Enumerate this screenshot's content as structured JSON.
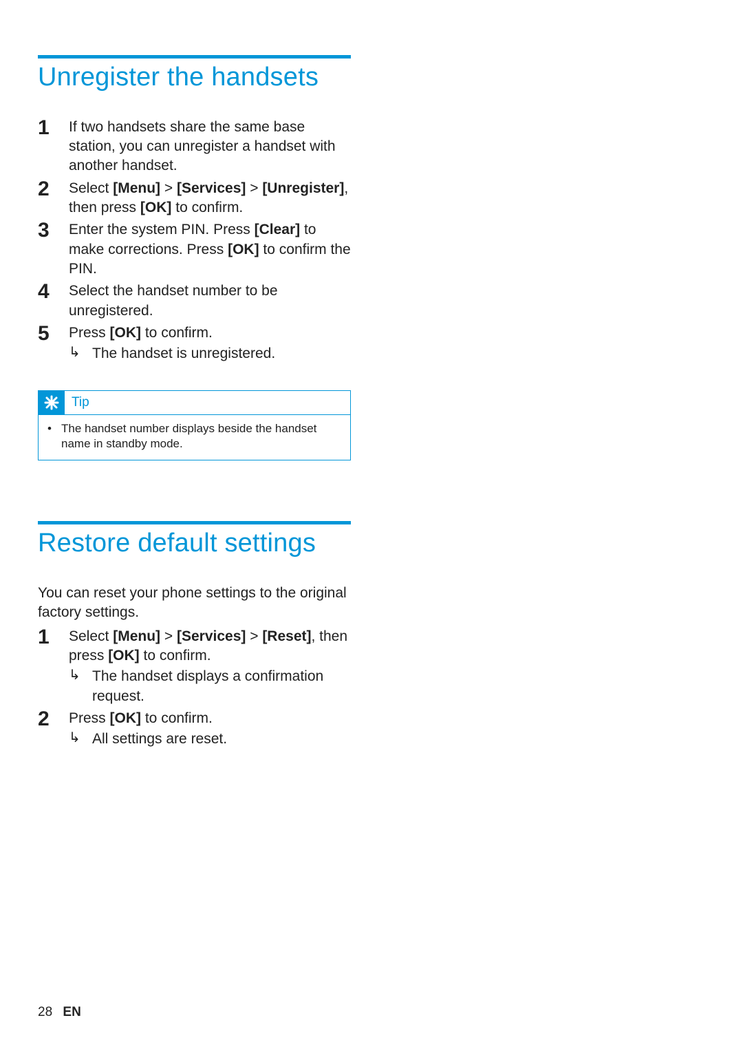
{
  "section1": {
    "title": "Unregister the handsets",
    "steps": {
      "n1": "1",
      "s1": "If two handsets share the same base station, you can unregister a handset with another handset.",
      "n2": "2",
      "s2a": "Select ",
      "s2_menu": "[Menu]",
      "s2_gt1": " > ",
      "s2_services": "[Services]",
      "s2_gt2": " > ",
      "s2_unreg": "[Unregister]",
      "s2b": ", then press ",
      "s2_ok": "[OK]",
      "s2c": " to confirm.",
      "n3": "3",
      "s3a": "Enter the system PIN. Press ",
      "s3_clear": "[Clear]",
      "s3b": " to make corrections. Press ",
      "s3_ok": "[OK]",
      "s3c": " to confirm the PIN.",
      "n4": "4",
      "s4": "Select the handset number to be unregistered.",
      "n5": "5",
      "s5a": "Press ",
      "s5_ok": "[OK]",
      "s5b": " to confirm.",
      "s5_result": "The handset is unregistered."
    },
    "tip": {
      "label": "Tip",
      "text": "The handset number displays beside the handset name in standby mode."
    }
  },
  "section2": {
    "title": "Restore default settings",
    "intro": "You can reset your phone settings to the original factory settings.",
    "steps": {
      "n1": "1",
      "s1a": "Select ",
      "s1_menu": "[Menu]",
      "s1_gt1": " > ",
      "s1_services": "[Services]",
      "s1_gt2": " > ",
      "s1_reset": "[Reset]",
      "s1b": ", then press ",
      "s1_ok": "[OK]",
      "s1c": " to confirm.",
      "s1_result": "The handset displays a confirmation request.",
      "n2": "2",
      "s2a": "Press ",
      "s2_ok": "[OK]",
      "s2b": " to confirm.",
      "s2_result": "All settings are reset."
    }
  },
  "footer": {
    "page": "28",
    "lang": "EN"
  },
  "glyph": {
    "bullet": "•",
    "arrow": "↳"
  }
}
